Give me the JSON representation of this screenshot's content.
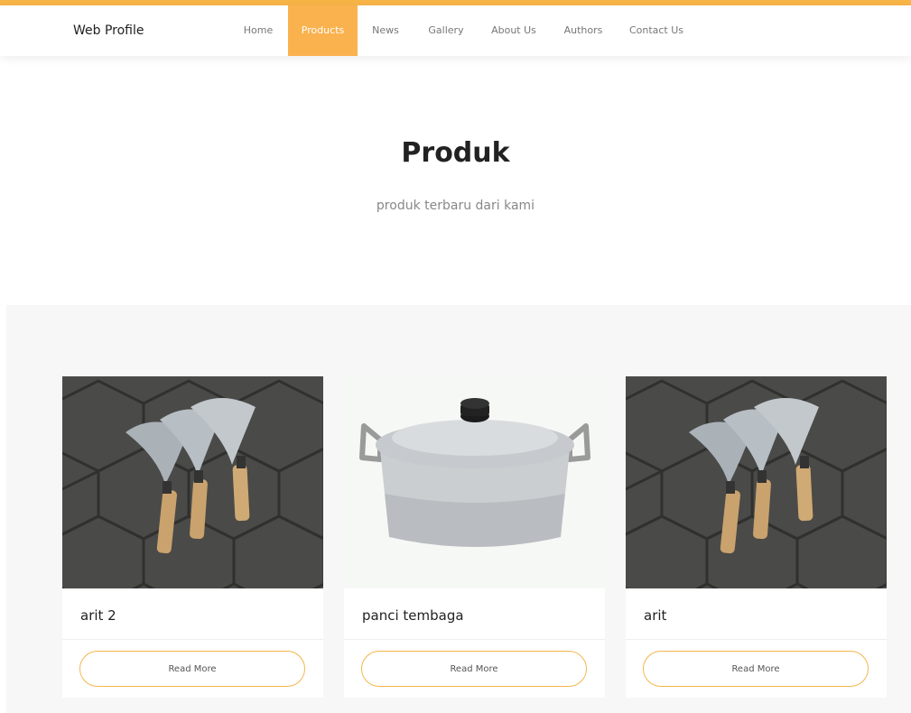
{
  "brand": "Web Profile",
  "nav": {
    "items": [
      {
        "label": "Home",
        "active": false
      },
      {
        "label": "Products",
        "active": true
      },
      {
        "label": "News",
        "active": false
      },
      {
        "label": "Gallery",
        "active": false
      },
      {
        "label": "About Us",
        "active": false
      },
      {
        "label": "Authors",
        "active": false
      },
      {
        "label": "Contact Us",
        "active": false
      }
    ]
  },
  "hero": {
    "title": "Produk",
    "subtitle": "produk terbaru dari kami"
  },
  "products": [
    {
      "title": "arit 2",
      "button": "Read More",
      "image": "sickles-photo"
    },
    {
      "title": "panci tembaga",
      "button": "Read More",
      "image": "pot-photo"
    },
    {
      "title": "arit",
      "button": "Read More",
      "image": "sickles-photo"
    }
  ],
  "colors": {
    "accent": "#f9b24e",
    "button_border": "#f3b64d",
    "section_bg": "#f7f7f7"
  }
}
